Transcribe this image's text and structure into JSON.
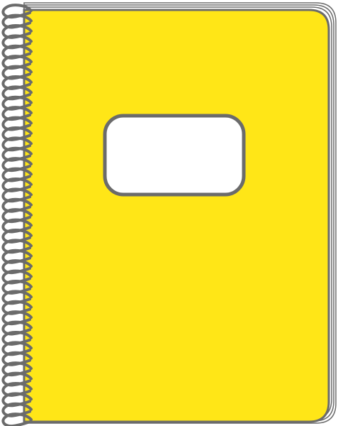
{
  "notebook": {
    "cover_color": "#FFE617",
    "outline_color": "#6B6B6B",
    "label_fill": "#FFFFFF",
    "page_edge_color": "#FFFFFF",
    "spiral": {
      "ring_count": 41,
      "ring_color": "#6B6B6B"
    },
    "label_text": ""
  }
}
